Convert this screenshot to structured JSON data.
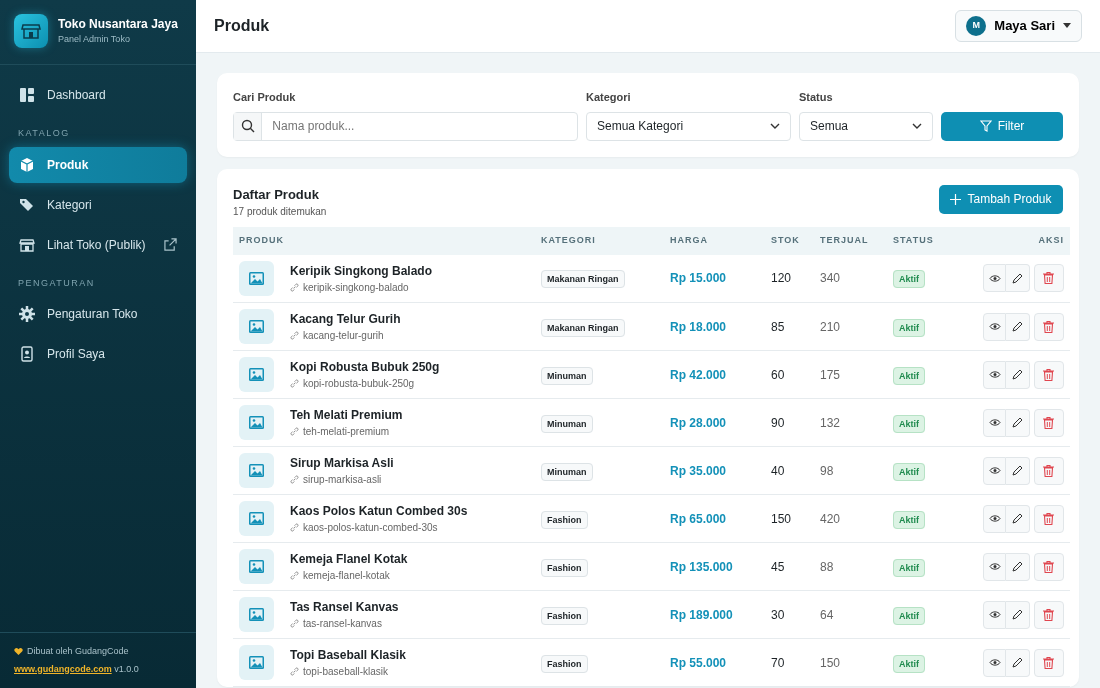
{
  "brand": {
    "name": "Toko Nusantara Jaya",
    "subtitle": "Panel Admin Toko"
  },
  "sidebar": {
    "items": [
      {
        "kind": "link",
        "label": "Dashboard",
        "selected": false
      },
      {
        "kind": "section",
        "label": "KATALOG"
      },
      {
        "kind": "link",
        "label": "Produk",
        "selected": true
      },
      {
        "kind": "link",
        "label": "Kategori",
        "selected": false
      },
      {
        "kind": "link",
        "label": "Lihat Toko (Publik)",
        "selected": false,
        "external": true
      },
      {
        "kind": "section",
        "label": "PENGATURAN"
      },
      {
        "kind": "link",
        "label": "Pengaturan Toko",
        "selected": false
      },
      {
        "kind": "link",
        "label": "Profil Saya",
        "selected": false
      }
    ],
    "footer": {
      "credit": "Dibuat oleh GudangCode",
      "url": "www.gudangcode.com",
      "version": "v1.0.0"
    }
  },
  "header": {
    "title": "Produk",
    "user": {
      "initial": "M",
      "name": "Maya Sari"
    }
  },
  "filters": {
    "search": {
      "label": "Cari Produk",
      "placeholder": "Nama produk..."
    },
    "category": {
      "label": "Kategori",
      "value": "Semua Kategori"
    },
    "status": {
      "label": "Status",
      "value": "Semua"
    },
    "button": "Filter"
  },
  "list": {
    "title": "Daftar Produk",
    "count": "17 produk ditemukan",
    "add_button": "Tambah Produk",
    "table": {
      "columns": [
        "PRODUK",
        "KATEGORI",
        "HARGA",
        "STOK",
        "TERJUAL",
        "STATUS",
        "AKSI"
      ],
      "rows": [
        {
          "name": "Keripik Singkong Balado",
          "slug": "keripik-singkong-balado",
          "category": "Makanan Ringan",
          "price": "Rp 15.000",
          "stock": "120",
          "sold": "340",
          "status": "Aktif"
        },
        {
          "name": "Kacang Telur Gurih",
          "slug": "kacang-telur-gurih",
          "category": "Makanan Ringan",
          "price": "Rp 18.000",
          "stock": "85",
          "sold": "210",
          "status": "Aktif"
        },
        {
          "name": "Kopi Robusta Bubuk 250g",
          "slug": "kopi-robusta-bubuk-250g",
          "category": "Minuman",
          "price": "Rp 42.000",
          "stock": "60",
          "sold": "175",
          "status": "Aktif"
        },
        {
          "name": "Teh Melati Premium",
          "slug": "teh-melati-premium",
          "category": "Minuman",
          "price": "Rp 28.000",
          "stock": "90",
          "sold": "132",
          "status": "Aktif"
        },
        {
          "name": "Sirup Markisa Asli",
          "slug": "sirup-markisa-asli",
          "category": "Minuman",
          "price": "Rp 35.000",
          "stock": "40",
          "sold": "98",
          "status": "Aktif"
        },
        {
          "name": "Kaos Polos Katun Combed 30s",
          "slug": "kaos-polos-katun-combed-30s",
          "category": "Fashion",
          "price": "Rp 65.000",
          "stock": "150",
          "sold": "420",
          "status": "Aktif"
        },
        {
          "name": "Kemeja Flanel Kotak",
          "slug": "kemeja-flanel-kotak",
          "category": "Fashion",
          "price": "Rp 135.000",
          "stock": "45",
          "sold": "88",
          "status": "Aktif"
        },
        {
          "name": "Tas Ransel Kanvas",
          "slug": "tas-ransel-kanvas",
          "category": "Fashion",
          "price": "Rp 189.000",
          "stock": "30",
          "sold": "64",
          "status": "Aktif"
        },
        {
          "name": "Topi Baseball Klasik",
          "slug": "topi-baseball-klasik",
          "category": "Fashion",
          "price": "Rp 55.000",
          "stock": "70",
          "sold": "150",
          "status": "Aktif"
        }
      ]
    }
  }
}
